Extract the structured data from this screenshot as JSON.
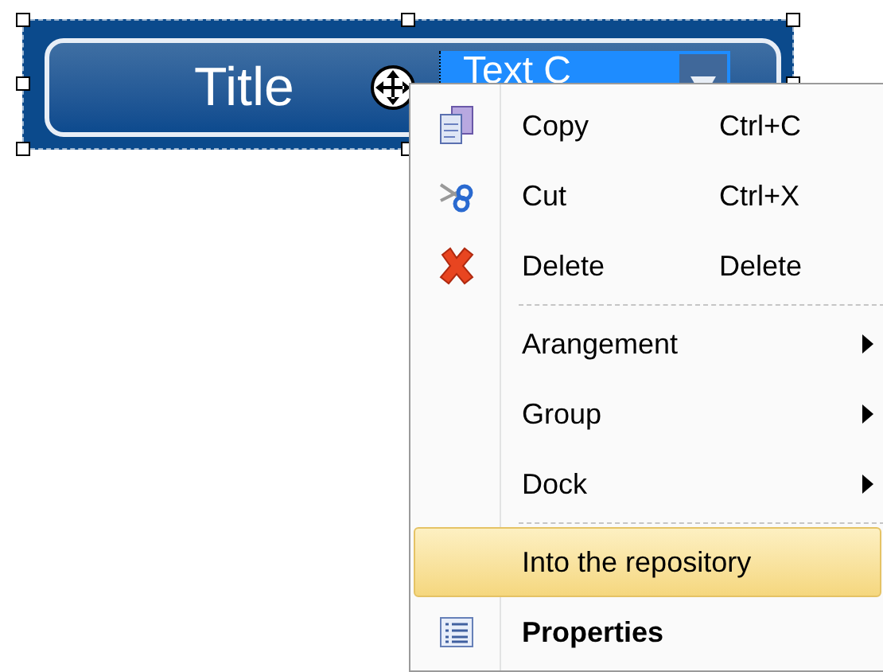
{
  "widget": {
    "title": "Title",
    "field": {
      "value": "Text C",
      "selected": true
    }
  },
  "context_menu": {
    "items": [
      {
        "kind": "command",
        "label": "Copy",
        "shortcut": "Ctrl+C",
        "selected": false,
        "default": false
      },
      {
        "kind": "command",
        "label": "Cut",
        "shortcut": "Ctrl+X",
        "selected": false,
        "default": false
      },
      {
        "kind": "command",
        "label": "Delete",
        "shortcut": "Delete",
        "selected": false,
        "default": false
      },
      {
        "kind": "separator"
      },
      {
        "kind": "submenu",
        "label": "Arangement",
        "selected": false,
        "default": false
      },
      {
        "kind": "submenu",
        "label": "Group",
        "selected": false,
        "default": false
      },
      {
        "kind": "submenu",
        "label": "Dock",
        "selected": false,
        "default": false
      },
      {
        "kind": "separator"
      },
      {
        "kind": "command",
        "label": "Into the repository",
        "selected": true,
        "default": false
      },
      {
        "kind": "command",
        "label": "Properties",
        "selected": false,
        "default": true
      }
    ]
  }
}
